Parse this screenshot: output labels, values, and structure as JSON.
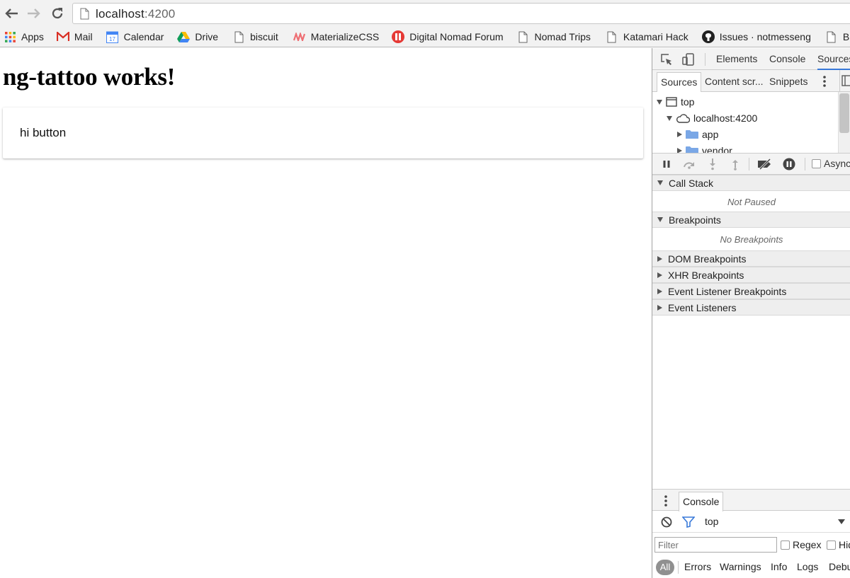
{
  "browser": {
    "url_host": "localhost",
    "url_port": ":4200",
    "bookmarks": [
      {
        "label": "Apps",
        "icon": "apps-grid-icon"
      },
      {
        "label": "Mail",
        "icon": "gmail-icon"
      },
      {
        "label": "Calendar",
        "icon": "calendar-icon",
        "icon_text": "17"
      },
      {
        "label": "Drive",
        "icon": "drive-icon"
      },
      {
        "label": "biscuit",
        "icon": "page-icon"
      },
      {
        "label": "MaterializeCSS",
        "icon": "materialize-icon"
      },
      {
        "label": "Digital Nomad Forum",
        "icon": "forum-icon"
      },
      {
        "label": "Nomad Trips",
        "icon": "page-icon"
      },
      {
        "label": "Katamari Hack",
        "icon": "page-icon"
      },
      {
        "label": "Issues · notmesseng",
        "icon": "github-icon"
      },
      {
        "label": "B",
        "icon": "page-icon"
      }
    ]
  },
  "page": {
    "heading": "ng-tattoo works!",
    "button_label": "hi button"
  },
  "devtools": {
    "tabs": [
      "Elements",
      "Console",
      "Sources"
    ],
    "active_tab": "Sources",
    "navigator_tabs": [
      "Sources",
      "Content scr...",
      "Snippets"
    ],
    "tree": {
      "top": "top",
      "origin": "localhost:4200",
      "folders": [
        "app",
        "vendor"
      ]
    },
    "async_label": "Async",
    "panes": {
      "call_stack": {
        "title": "Call Stack",
        "empty": "Not Paused"
      },
      "breakpoints": {
        "title": "Breakpoints",
        "empty": "No Breakpoints"
      },
      "dom_breakpoints": "DOM Breakpoints",
      "xhr_breakpoints": "XHR Breakpoints",
      "event_listener_breakpoints": "Event Listener Breakpoints",
      "event_listeners": "Event Listeners"
    },
    "drawer": {
      "tab": "Console",
      "context": "top",
      "filter_placeholder": "Filter",
      "regex_label": "Regex",
      "hide_label": "Hid",
      "levels": [
        "All",
        "Errors",
        "Warnings",
        "Info",
        "Logs",
        "Debu"
      ]
    },
    "colors": {
      "accent": "#3879d9",
      "folder": "#7aa7e6"
    }
  }
}
